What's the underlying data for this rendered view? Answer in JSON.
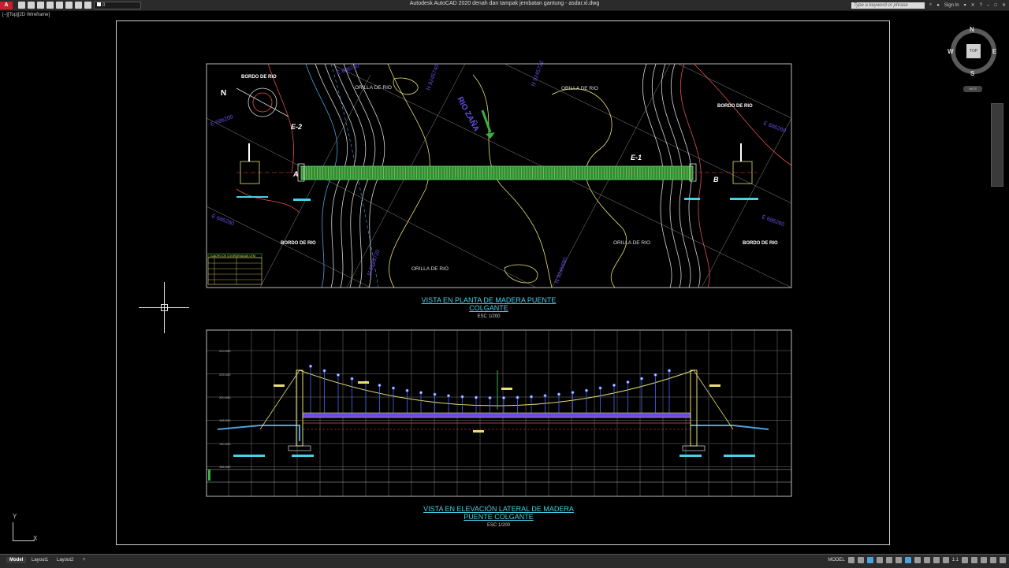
{
  "app": {
    "logo": "A",
    "window_title": "Autodesk AutoCAD 2020    denah dan tampak jembatan gantung - asdar.xl.dwg",
    "search_placeholder": "Type a keyword or phrase",
    "sign_in": "Sign In",
    "layer_current": "0"
  },
  "viewport": {
    "label": "[−][Top][2D Wireframe]"
  },
  "viewcube": {
    "face": "TOP",
    "north": "N",
    "south": "S",
    "east": "E",
    "west": "W",
    "wcs": "WCS"
  },
  "drawing": {
    "plan_title_1": "VISTA EN PLANTA DE MADERA PUENTE",
    "plan_title_2": "COLGANTE",
    "plan_scale": "ESC 1/200",
    "elev_title_1": "VISTA EN ELEVACIÓN LATERAL DE MADERA",
    "elev_title_2": "PUENTE COLGANTE",
    "elev_scale": "ESC 1/200",
    "labels": {
      "bordo_tl": "BORDO DE RIO",
      "bordo_tr": "BORDO DE RIO",
      "bordo_bl": "BORDO DE RIO",
      "bordo_br": "BORDO DE RIO",
      "orilla_1": "ORILLA DE RIO",
      "orilla_2": "ORILLA DE RIO",
      "orilla_3": "ORILLA DE RIO",
      "orilla_4": "ORILLA DE RIO",
      "rio": "RIO ZAÑA",
      "e1": "E-1",
      "e2": "E-2",
      "a": "A",
      "b": "B",
      "north": "N",
      "coord_table_title": "CUADRO DE COORDENADAS UTM"
    },
    "grid_labels_plan": [
      "E 686240",
      "E 686260",
      "E 686280",
      "E 686200",
      "E 686260",
      "N 9245740",
      "N 9245720",
      "N 9245720",
      "N 9245680"
    ],
    "elev_levels": [
      "210.000",
      "205.000",
      "200.000",
      "195.000",
      "190.000",
      "185.000"
    ]
  },
  "status": {
    "tab_model": "Model",
    "tab_layout1": "Layout1",
    "tab_layout2": "Layout2",
    "tab_add": "+",
    "model_btn": "MODEL",
    "scale": "1:1"
  },
  "ucs": {
    "x": "X",
    "y": "Y"
  }
}
